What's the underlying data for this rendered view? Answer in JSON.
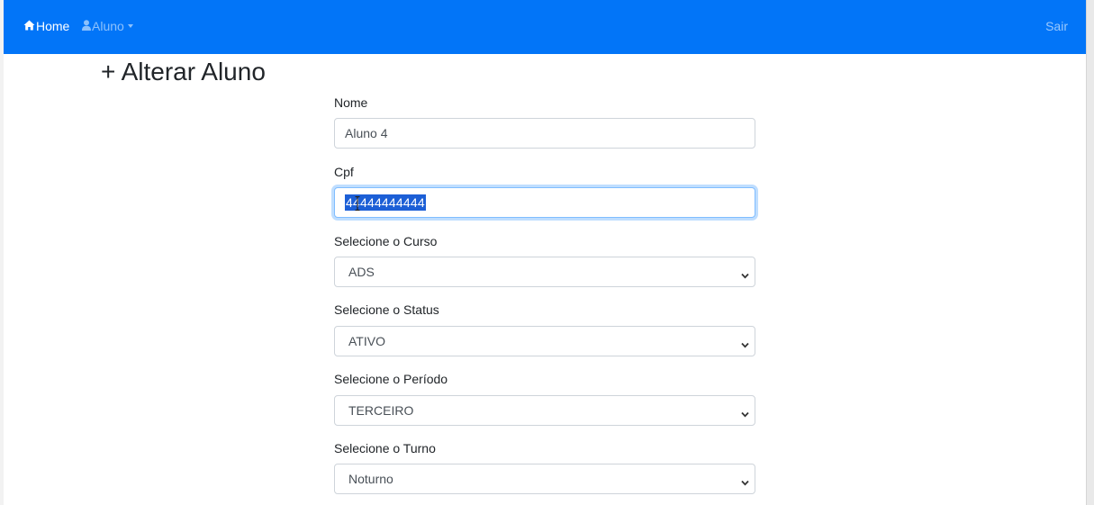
{
  "navbar": {
    "home_label": "Home",
    "aluno_label": "Aluno",
    "sair_label": "Sair",
    "background_color": "#0275f8"
  },
  "page": {
    "title": "+ Alterar Aluno"
  },
  "form": {
    "nome": {
      "label": "Nome",
      "value": "Aluno 4"
    },
    "cpf": {
      "label": "Cpf",
      "value": "44444444444"
    },
    "curso": {
      "label": "Selecione o Curso",
      "value": "ADS"
    },
    "status": {
      "label": "Selecione o Status",
      "value": "ATIVO"
    },
    "periodo": {
      "label": "Selecione o Período",
      "value": "TERCEIRO"
    },
    "turno": {
      "label": "Selecione o Turno",
      "value": "Noturno"
    }
  }
}
